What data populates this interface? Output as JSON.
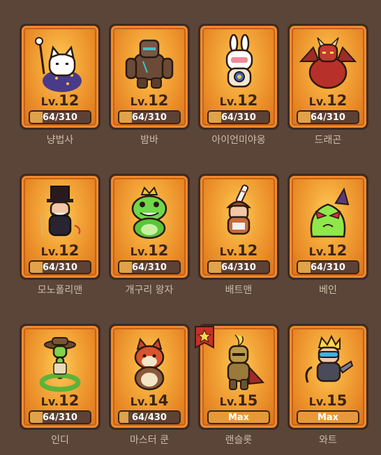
{
  "heroes": [
    {
      "name": "냥법사",
      "level_prefix": "Lv.",
      "level": "12",
      "progress": "64/310",
      "fill_fraction": 0.206,
      "portrait_icon": "cat-wizard-icon"
    },
    {
      "name": "밤바",
      "level_prefix": "Lv.",
      "level": "12",
      "progress": "64/310",
      "fill_fraction": 0.206,
      "portrait_icon": "stone-golem-icon"
    },
    {
      "name": "아이언미야옹",
      "level_prefix": "Lv.",
      "level": "12",
      "progress": "64/310",
      "fill_fraction": 0.206,
      "portrait_icon": "bunny-robot-icon"
    },
    {
      "name": "드래곤",
      "level_prefix": "Lv.",
      "level": "12",
      "progress": "64/310",
      "fill_fraction": 0.206,
      "portrait_icon": "red-dragon-icon"
    },
    {
      "name": "모노폴리맨",
      "level_prefix": "Lv.",
      "level": "12",
      "progress": "64/310",
      "fill_fraction": 0.206,
      "portrait_icon": "top-hat-man-icon"
    },
    {
      "name": "개구리 왕자",
      "level_prefix": "Lv.",
      "level": "12",
      "progress": "64/310",
      "fill_fraction": 0.206,
      "portrait_icon": "frog-prince-icon"
    },
    {
      "name": "배트맨",
      "level_prefix": "Lv.",
      "level": "12",
      "progress": "64/310",
      "fill_fraction": 0.206,
      "portrait_icon": "bat-man-icon"
    },
    {
      "name": "베인",
      "level_prefix": "Lv.",
      "level": "12",
      "progress": "64/310",
      "fill_fraction": 0.206,
      "portrait_icon": "green-slime-icon"
    },
    {
      "name": "인디",
      "level_prefix": "Lv.",
      "level": "12",
      "progress": "64/310",
      "fill_fraction": 0.206,
      "portrait_icon": "snake-explorer-icon"
    },
    {
      "name": "마스터 쿤",
      "level_prefix": "Lv.",
      "level": "14",
      "progress": "64/430",
      "fill_fraction": 0.149,
      "portrait_icon": "red-panda-icon"
    },
    {
      "name": "랜슬롯",
      "level_prefix": "Lv.",
      "level": "15",
      "progress": "Max",
      "fill_fraction": 1,
      "portrait_icon": "gold-knight-icon",
      "badge_icon": "star-flag-icon"
    },
    {
      "name": "와트",
      "level_prefix": "Lv.",
      "level": "15",
      "progress": "Max",
      "fill_fraction": 1,
      "portrait_icon": "crowned-goggles-icon"
    }
  ],
  "colors": {
    "background": "#5b4538",
    "card_orange": "#f08a2c",
    "card_glow": "#ffcf5a",
    "bar": "#5d4135",
    "name_text": "#cdbba8"
  }
}
